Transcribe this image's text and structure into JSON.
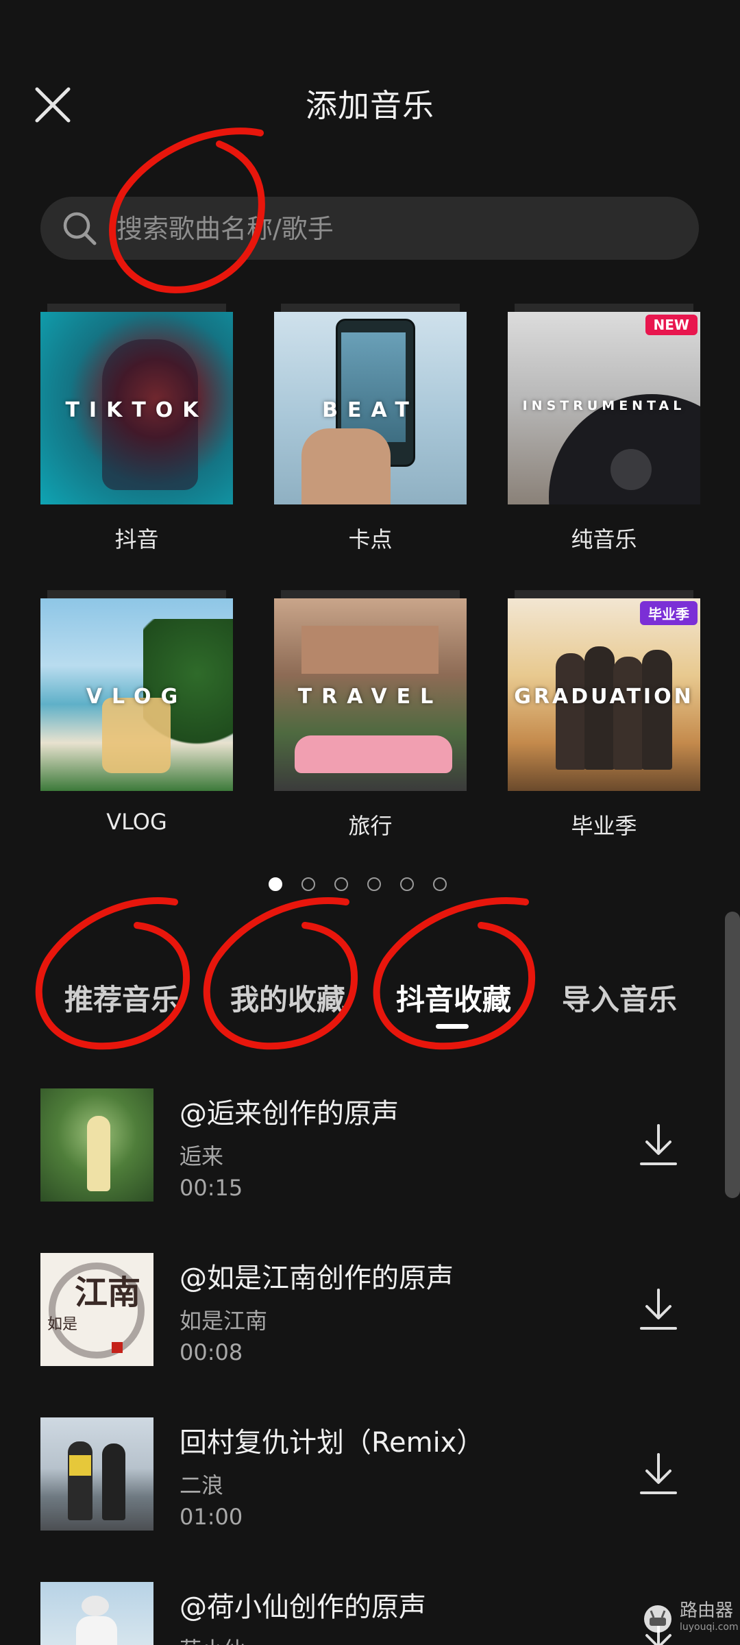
{
  "header": {
    "title": "添加音乐",
    "close_icon": "close-icon"
  },
  "search": {
    "placeholder": "搜索歌曲名称/歌手",
    "icon": "search-icon"
  },
  "categories": [
    {
      "label": "抖音",
      "overlay": "TIKTOK",
      "badge": ""
    },
    {
      "label": "卡点",
      "overlay": "BEAT",
      "badge": ""
    },
    {
      "label": "纯音乐",
      "overlay": "INSTRUMENTAL",
      "badge": "NEW"
    },
    {
      "label": "VLOG",
      "overlay": "VLOG",
      "badge": ""
    },
    {
      "label": "旅行",
      "overlay": "TRAVEL",
      "badge": ""
    },
    {
      "label": "毕业季",
      "overlay": "GRADUATION",
      "badge": "毕业季"
    }
  ],
  "pagination": {
    "pages": 6,
    "current": 1
  },
  "tabs": [
    {
      "label": "推荐音乐",
      "active": false
    },
    {
      "label": "我的收藏",
      "active": false
    },
    {
      "label": "抖音收藏",
      "active": true
    },
    {
      "label": "导入音乐",
      "active": false
    }
  ],
  "songs": [
    {
      "title": "@逅来创作的原声",
      "artist": "逅来",
      "duration": "00:15"
    },
    {
      "title": "@如是江南创作的原声",
      "artist": "如是江南",
      "duration": "00:08"
    },
    {
      "title": "回村复仇计划（Remix）",
      "artist": "二浪",
      "duration": "01:00"
    },
    {
      "title": "@荷小仙创作的原声",
      "artist": "荷小仙",
      "duration": ""
    }
  ],
  "cover_text": {
    "jiangnan_big": "江南",
    "jiangnan_small": "如是"
  },
  "watermark": {
    "text": "路由器",
    "sub": "luyouqi.com"
  },
  "colors": {
    "background": "#141414",
    "annotation": "#e8160c",
    "badge_new": "#e8164e",
    "badge_grad": "#7b2fd6"
  }
}
